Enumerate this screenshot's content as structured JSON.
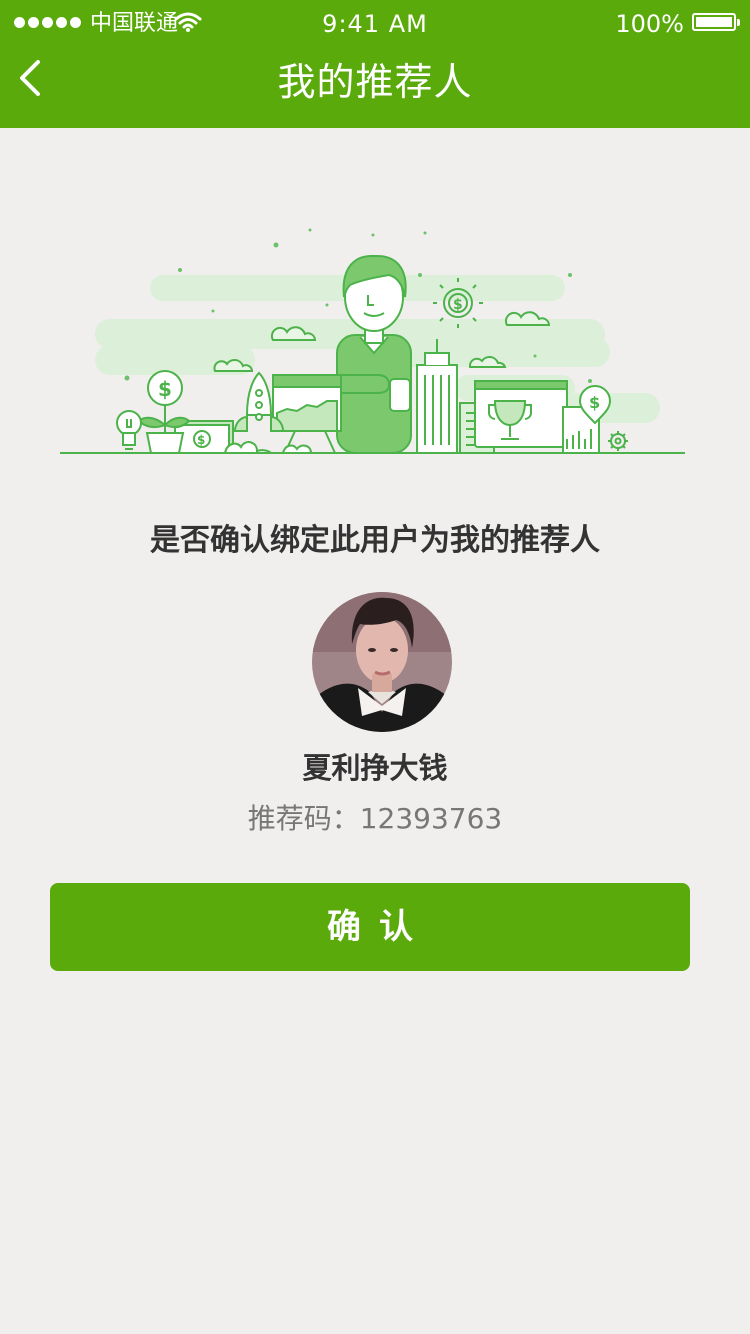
{
  "status_bar": {
    "carrier": "中国联通",
    "time": "9:41 AM",
    "battery": "100%"
  },
  "nav": {
    "title": "我的推荐人"
  },
  "main": {
    "question": "是否确认绑定此用户为我的推荐人",
    "user_name": "夏利挣大钱",
    "referral_code": "推荐码：12393763",
    "confirm_label": "确认"
  },
  "colors": {
    "accent": "#5aaa0b",
    "background": "#f0efee",
    "illustration_green": "#4cb24a"
  }
}
